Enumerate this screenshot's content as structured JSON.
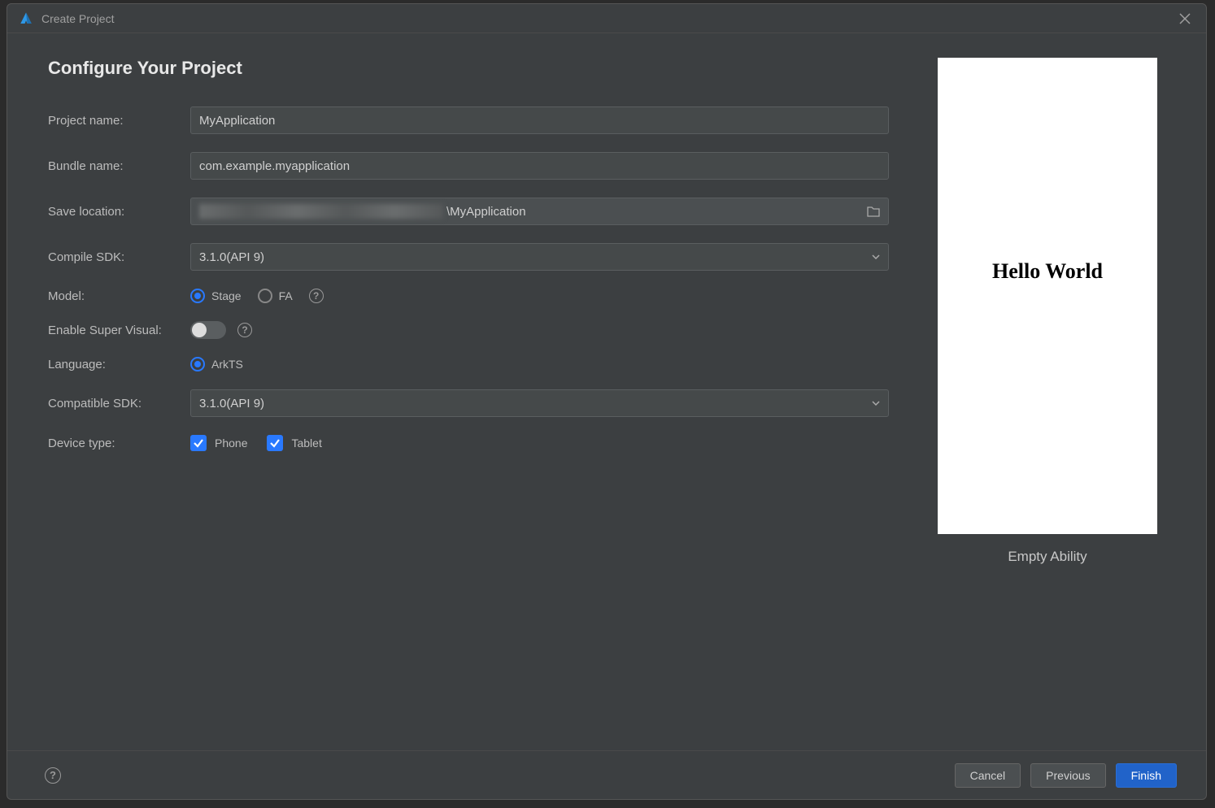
{
  "dialog": {
    "title": "Create Project"
  },
  "page": {
    "heading": "Configure Your Project"
  },
  "form": {
    "project_name": {
      "label": "Project name:",
      "value": "MyApplication"
    },
    "bundle_name": {
      "label": "Bundle name:",
      "value": "com.example.myapplication"
    },
    "save_location": {
      "label": "Save location:",
      "suffix": "\\MyApplication"
    },
    "compile_sdk": {
      "label": "Compile SDK:",
      "value": "3.1.0(API 9)"
    },
    "model": {
      "label": "Model:",
      "options": {
        "stage": "Stage",
        "fa": "FA"
      },
      "selected": "stage"
    },
    "super_visual": {
      "label": "Enable Super Visual:",
      "enabled": false
    },
    "language": {
      "label": "Language:",
      "options": {
        "arkts": "ArkTS"
      },
      "selected": "arkts"
    },
    "compatible_sdk": {
      "label": "Compatible SDK:",
      "value": "3.1.0(API 9)"
    },
    "device_type": {
      "label": "Device type:",
      "phone": "Phone",
      "tablet": "Tablet",
      "phone_checked": true,
      "tablet_checked": true
    }
  },
  "preview": {
    "text": "Hello World",
    "caption": "Empty Ability"
  },
  "footer": {
    "cancel": "Cancel",
    "previous": "Previous",
    "finish": "Finish"
  }
}
